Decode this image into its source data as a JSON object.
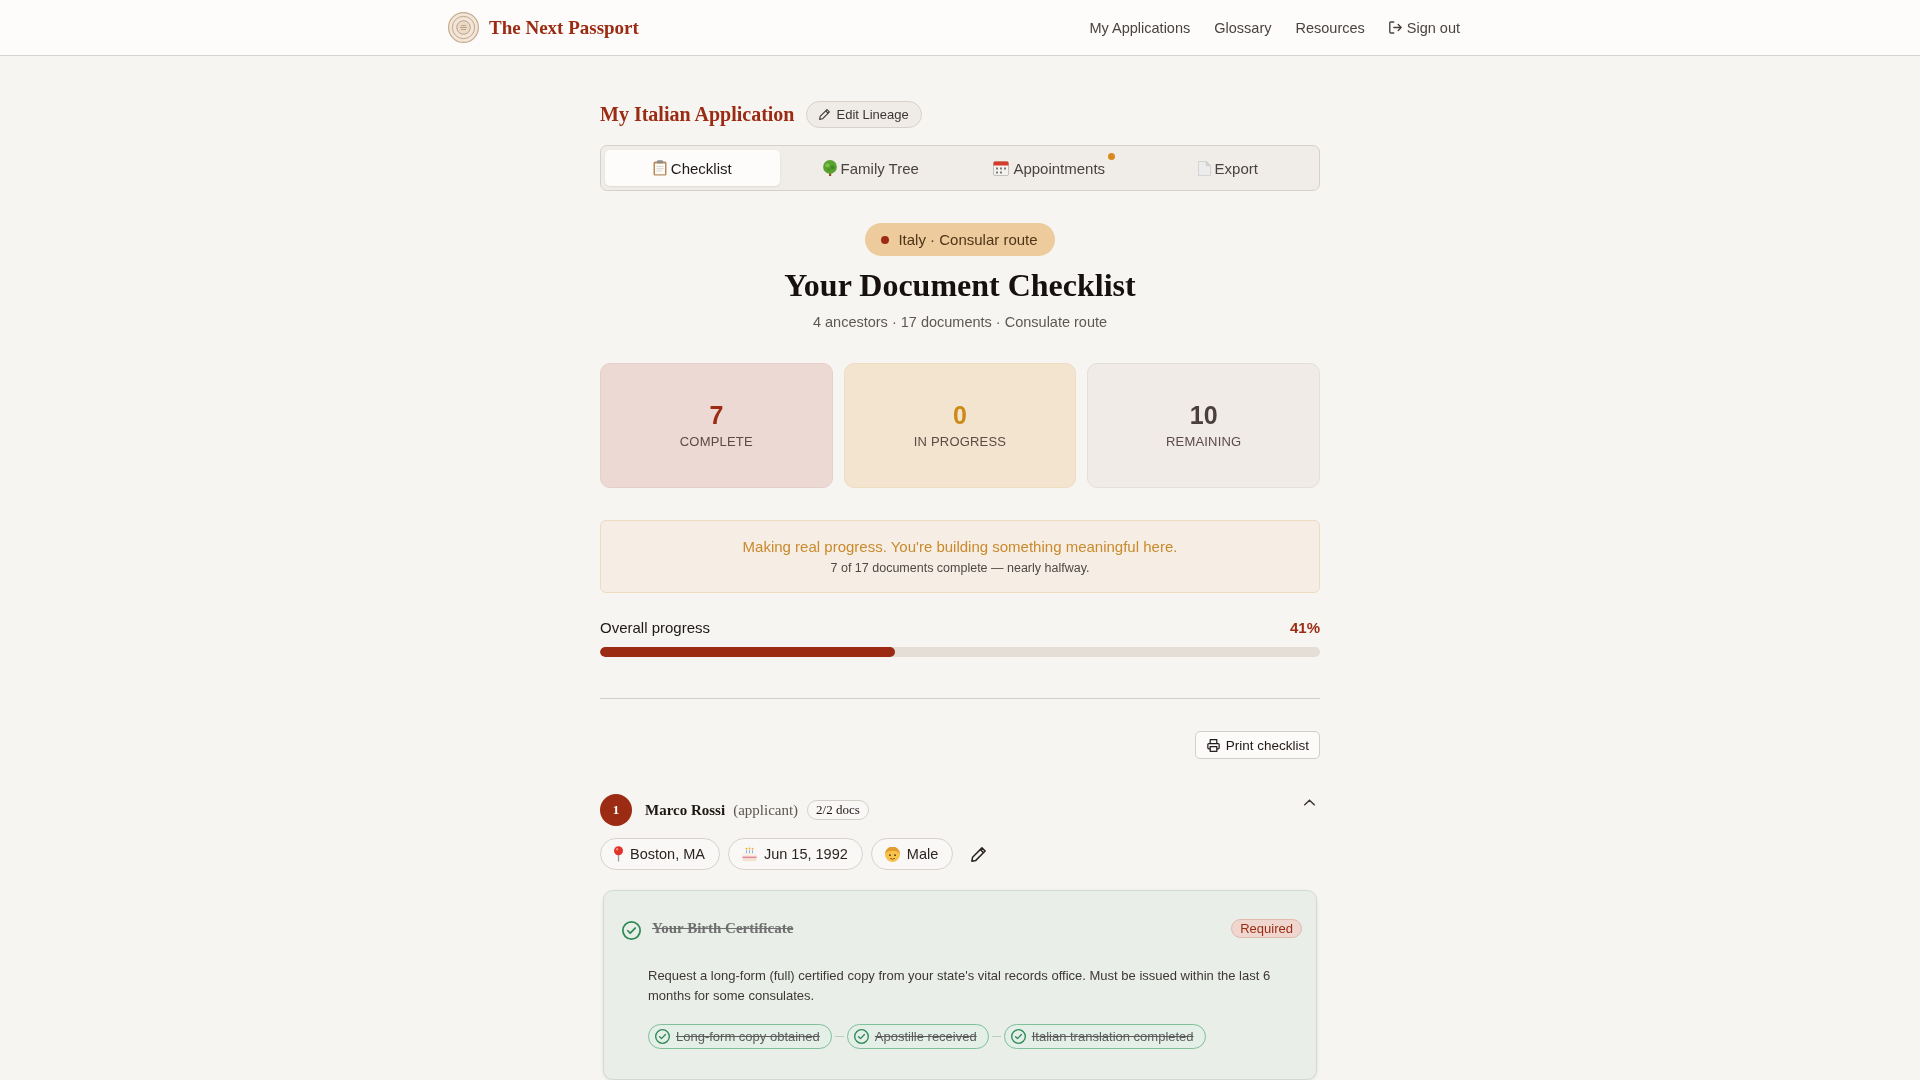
{
  "header": {
    "brand": "The Next Passport",
    "nav": [
      {
        "label": "My Applications"
      },
      {
        "label": "Glossary"
      },
      {
        "label": "Resources"
      }
    ],
    "sign_out": "Sign out"
  },
  "application": {
    "title": "My Italian Application",
    "edit_button": "Edit Lineage"
  },
  "tabs": [
    {
      "label": "Checklist",
      "selected": true,
      "notification": false
    },
    {
      "label": "Family Tree",
      "selected": false,
      "notification": false
    },
    {
      "label": "Appointments",
      "selected": false,
      "notification": true
    },
    {
      "label": "Export",
      "selected": false,
      "notification": false
    }
  ],
  "route_badge": "Italy · Consular route",
  "heading": "Your Document Checklist",
  "summary": "4 ancestors · 17 documents · Consulate route",
  "stats": [
    {
      "kind": "complete",
      "value": "7",
      "label": "COMPLETE"
    },
    {
      "kind": "in_progress",
      "value": "0",
      "label": "IN PROGRESS"
    },
    {
      "kind": "remaining",
      "value": "10",
      "label": "REMAINING"
    }
  ],
  "message": {
    "headline": "Making real progress. You're building something meaningful here.",
    "detail": "7 of 17 documents complete — nearly halfway."
  },
  "progress": {
    "label": "Overall progress",
    "reading": "41%",
    "level": 0.41
  },
  "print_button": "Print checklist",
  "people": [
    {
      "number": "1",
      "name": "Marco Rossi",
      "role": "(applicant)",
      "docs": "2/2 docs",
      "expanded": true,
      "details": [
        {
          "kind": "place",
          "text": "Boston, MA"
        },
        {
          "kind": "birth",
          "text": "Jun 15, 1992"
        },
        {
          "kind": "gender",
          "text": "Male"
        }
      ],
      "documents": [
        {
          "title": "Your Birth Certificate",
          "complete": true,
          "tag": "Required",
          "description": "Request a long-form (full) certified copy from your state's vital records office. Must be issued within the last 6 months for some consulates.",
          "steps": [
            {
              "label": "Long-form copy obtained",
              "done": true
            },
            {
              "label": "Apostille received",
              "done": true
            },
            {
              "label": "Italian translation completed",
              "done": true
            }
          ]
        }
      ]
    }
  ]
}
